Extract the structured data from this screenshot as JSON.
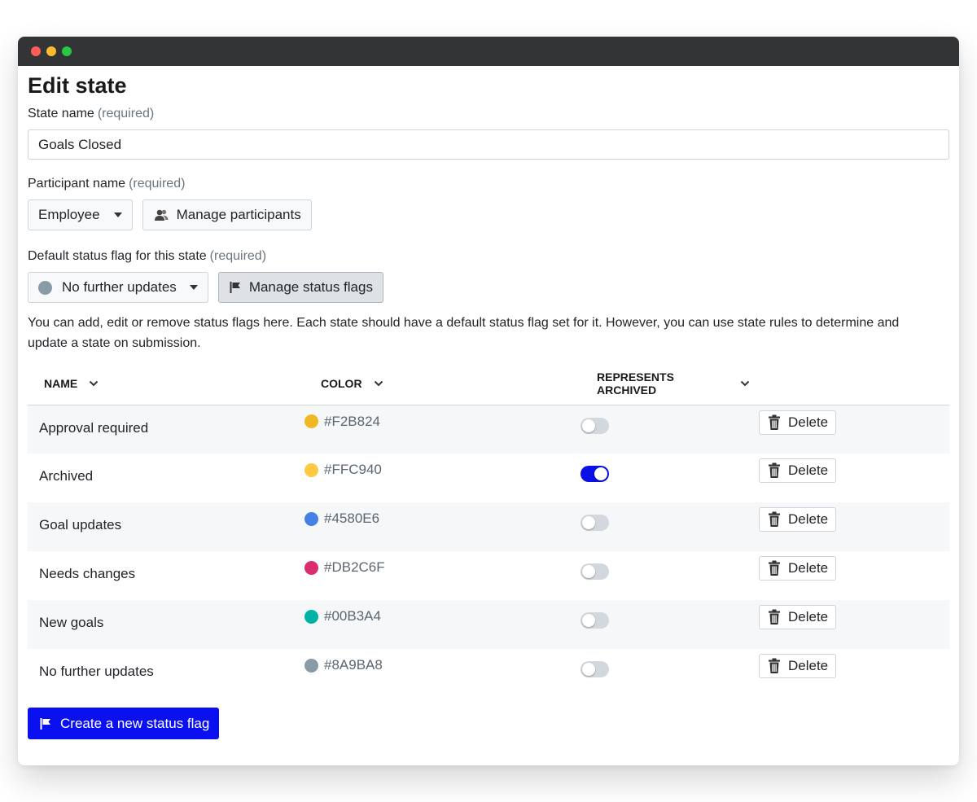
{
  "window": {
    "controls": [
      "#ff5f57",
      "#febc2e",
      "#28c840"
    ]
  },
  "page": {
    "title": "Edit state"
  },
  "state_name": {
    "label": "State name",
    "required": "(required)",
    "value": "Goals Closed"
  },
  "participant": {
    "label": "Participant name",
    "required": "(required)",
    "selected": "Employee",
    "manage_label": "Manage participants"
  },
  "status_flag": {
    "label": "Default status flag for this state",
    "required": "(required)",
    "selected": "No further updates",
    "selected_color": "#8A9BA8",
    "manage_label": "Manage status flags"
  },
  "help_text": "You can add, edit or remove status flags here. Each state should have a default status flag set for it. However, you can use state rules to determine and update a state on submission.",
  "table": {
    "headers": {
      "name": "NAME",
      "color": "COLOR",
      "archived": "REPRESENTS ARCHIVED"
    },
    "delete_label": "Delete",
    "rows": [
      {
        "name": "Approval required",
        "color": "#F2B824",
        "archived": false
      },
      {
        "name": "Archived",
        "color": "#FFC940",
        "archived": true
      },
      {
        "name": "Goal updates",
        "color": "#4580E6",
        "archived": false
      },
      {
        "name": "Needs changes",
        "color": "#DB2C6F",
        "archived": false
      },
      {
        "name": "New goals",
        "color": "#00B3A4",
        "archived": false
      },
      {
        "name": "No further updates",
        "color": "#8A9BA8",
        "archived": false
      }
    ]
  },
  "create_button": {
    "label": "Create a new status flag"
  },
  "colors": {
    "primary": "#0A10F0",
    "titlebar": "#333436"
  }
}
